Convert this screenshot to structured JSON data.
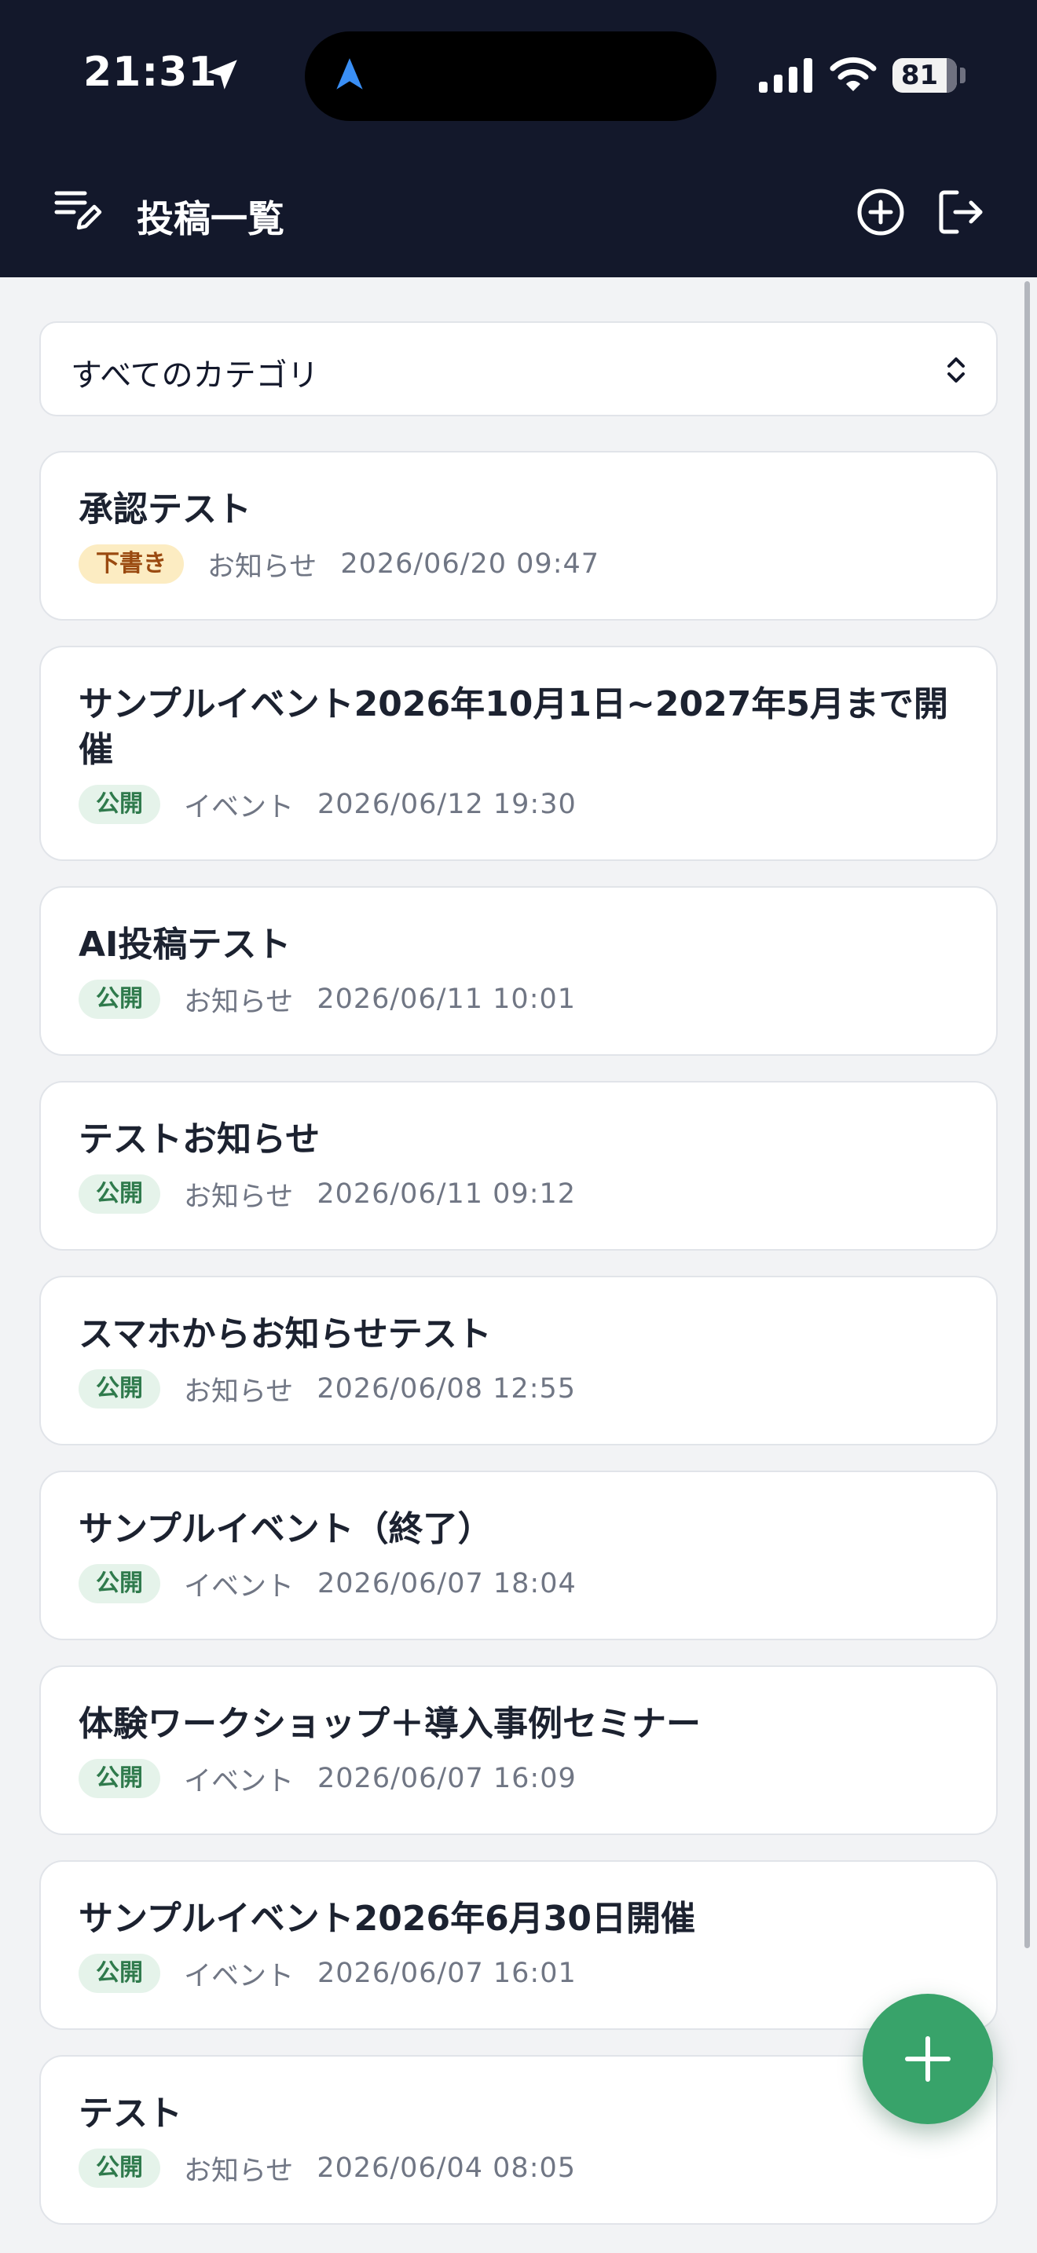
{
  "status_bar": {
    "time": "21:31",
    "battery": "81",
    "battery_level_percent": 81
  },
  "header": {
    "title": "投稿一覧",
    "icons": [
      "menu-edit-icon",
      "add-circle-icon",
      "logout-icon"
    ]
  },
  "filter": {
    "selected_category": "すべてのカテゴリ"
  },
  "posts": [
    {
      "title": "承認テスト",
      "status": "下書き",
      "status_type": "draft",
      "category": "お知らせ",
      "date": "2026/06/20 09:47"
    },
    {
      "title": "サンプルイベント2026年10月1日~2027年5月まで開催",
      "status": "公開",
      "status_type": "public",
      "category": "イベント",
      "date": "2026/06/12 19:30"
    },
    {
      "title": "AI投稿テスト",
      "status": "公開",
      "status_type": "public",
      "category": "お知らせ",
      "date": "2026/06/11 10:01"
    },
    {
      "title": "テストお知らせ",
      "status": "公開",
      "status_type": "public",
      "category": "お知らせ",
      "date": "2026/06/11 09:12"
    },
    {
      "title": "スマホからお知らせテスト",
      "status": "公開",
      "status_type": "public",
      "category": "お知らせ",
      "date": "2026/06/08 12:55"
    },
    {
      "title": "サンプルイベント（終了）",
      "status": "公開",
      "status_type": "public",
      "category": "イベント",
      "date": "2026/06/07 18:04"
    },
    {
      "title": "体験ワークショップ＋導入事例セミナー",
      "status": "公開",
      "status_type": "public",
      "category": "イベント",
      "date": "2026/06/07 16:09"
    },
    {
      "title": "サンプルイベント2026年6月30日開催",
      "status": "公開",
      "status_type": "public",
      "category": "イベント",
      "date": "2026/06/07 16:01"
    },
    {
      "title": "テスト",
      "status": "公開",
      "status_type": "public",
      "category": "お知らせ",
      "date": "2026/06/04 08:05"
    }
  ],
  "fab": {
    "icon": "plus-icon"
  },
  "colors": {
    "header_bg": "#13182b",
    "page_bg": "#f2f3f5",
    "accent_green": "#38a36a",
    "draft_badge_bg": "#fcecc2",
    "public_badge_bg": "#e5f3ea"
  }
}
